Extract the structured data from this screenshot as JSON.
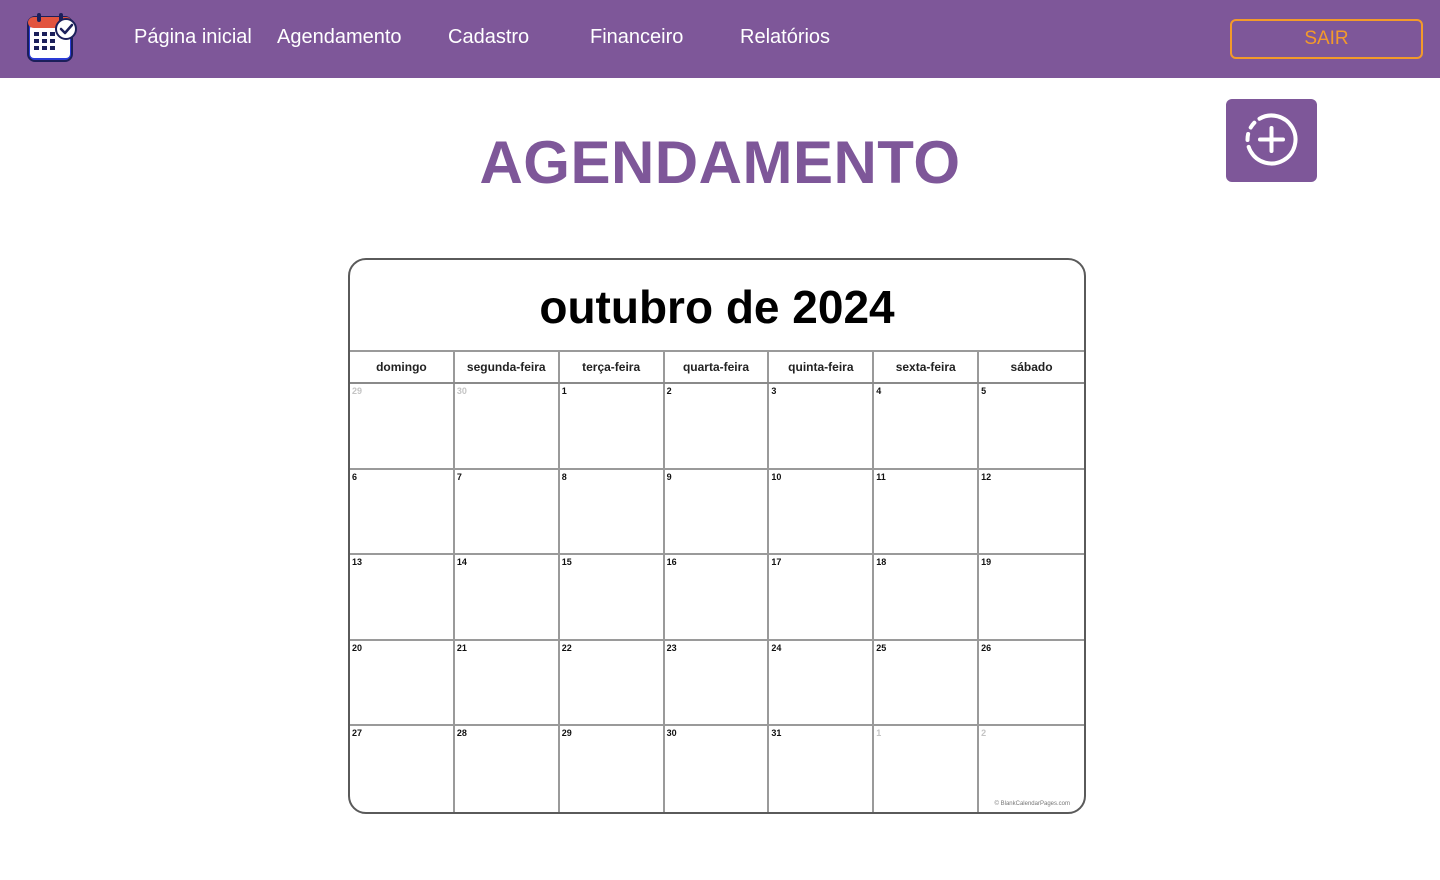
{
  "nav": {
    "items": [
      "Página inicial",
      "Agendamento",
      "Cadastro",
      "Financeiro",
      "Relatórios"
    ],
    "logout_label": "SAIR"
  },
  "page": {
    "title": "AGENDAMENTO"
  },
  "calendar": {
    "title": "outubro de 2024",
    "weekdays": [
      "domingo",
      "segunda-feira",
      "terça-feira",
      "quarta-feira",
      "quinta-feira",
      "sexta-feira",
      "sábado"
    ],
    "days": [
      {
        "n": "29",
        "muted": true
      },
      {
        "n": "30",
        "muted": true
      },
      {
        "n": "1"
      },
      {
        "n": "2"
      },
      {
        "n": "3"
      },
      {
        "n": "4"
      },
      {
        "n": "5"
      },
      {
        "n": "6"
      },
      {
        "n": "7"
      },
      {
        "n": "8"
      },
      {
        "n": "9"
      },
      {
        "n": "10"
      },
      {
        "n": "11"
      },
      {
        "n": "12"
      },
      {
        "n": "13"
      },
      {
        "n": "14"
      },
      {
        "n": "15"
      },
      {
        "n": "16"
      },
      {
        "n": "17"
      },
      {
        "n": "18"
      },
      {
        "n": "19"
      },
      {
        "n": "20"
      },
      {
        "n": "21"
      },
      {
        "n": "22"
      },
      {
        "n": "23"
      },
      {
        "n": "24"
      },
      {
        "n": "25"
      },
      {
        "n": "26"
      },
      {
        "n": "27"
      },
      {
        "n": "28"
      },
      {
        "n": "29"
      },
      {
        "n": "30"
      },
      {
        "n": "31"
      },
      {
        "n": "1",
        "muted": true
      },
      {
        "n": "2",
        "muted": true
      }
    ],
    "credit": "© BlankCalendarPages.com"
  },
  "colors": {
    "brand": "#7e5799",
    "accent": "#f39a2a"
  },
  "icons": {
    "logo": "calendar-check-icon",
    "add": "circle-plus-icon"
  }
}
